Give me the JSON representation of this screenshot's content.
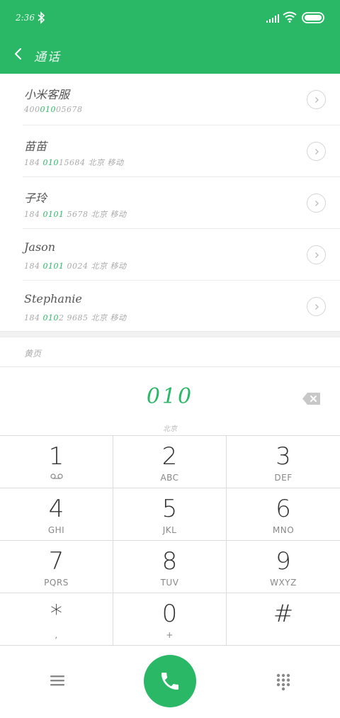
{
  "status_bar": {
    "time": "2:36"
  },
  "app_bar": {
    "title": "通话"
  },
  "contacts": [
    {
      "name": "小米客服",
      "pre": "400",
      "match": "010",
      "post": "05678",
      "location": ""
    },
    {
      "name": "苗苗",
      "pre": "184 ",
      "match": "010",
      "post": "15684",
      "location": "北京 移动"
    },
    {
      "name": "子玲",
      "pre": "184 ",
      "match": "0101",
      "post": " 5678",
      "location": "北京 移动"
    },
    {
      "name": "Jason",
      "pre": "184 ",
      "match": "0101",
      "post": " 0024",
      "location": "北京 移动"
    },
    {
      "name": "Stephanie",
      "pre": "184 ",
      "match": "010",
      "post": "2 9685",
      "location": "北京 移动"
    }
  ],
  "section_label": "黄页",
  "dialer": {
    "number": "010",
    "location": "北京"
  },
  "keypad": [
    {
      "digit": "1",
      "letters": ""
    },
    {
      "digit": "2",
      "letters": "ABC"
    },
    {
      "digit": "3",
      "letters": "DEF"
    },
    {
      "digit": "4",
      "letters": "GHI"
    },
    {
      "digit": "5",
      "letters": "JKL"
    },
    {
      "digit": "6",
      "letters": "MNO"
    },
    {
      "digit": "7",
      "letters": "PQRS"
    },
    {
      "digit": "8",
      "letters": "TUV"
    },
    {
      "digit": "9",
      "letters": "WXYZ"
    },
    {
      "digit": "*",
      "letters": ","
    },
    {
      "digit": "0",
      "letters": "+"
    },
    {
      "digit": "#",
      "letters": ""
    }
  ],
  "icons": {
    "status": [
      "bluetooth-icon",
      "signal-icon",
      "wifi-icon",
      "battery-icon"
    ],
    "navigation": [
      "back-icon",
      "chevron-right-icon",
      "backspace-icon",
      "voicemail-icon",
      "menu-icon",
      "phone-icon",
      "dialpad-icon"
    ]
  },
  "colors": {
    "accent": "#2bb866",
    "divider": "#dcdcdc"
  }
}
